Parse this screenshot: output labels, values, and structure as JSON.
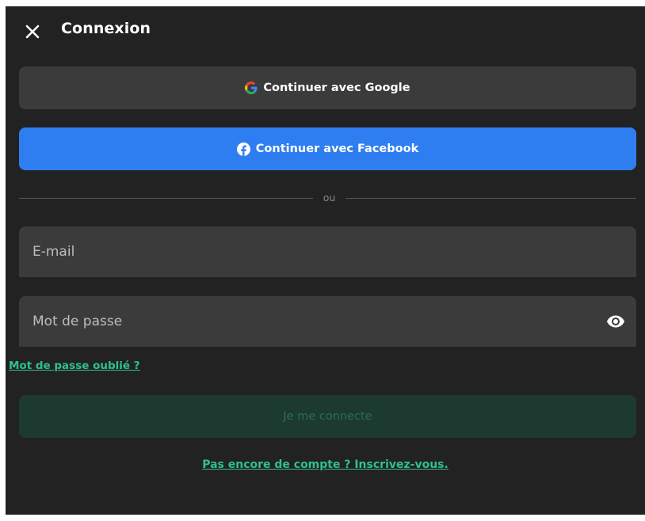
{
  "header": {
    "title": "Connexion",
    "close_icon": "close-icon"
  },
  "social": {
    "google_label": "Continuer avec Google",
    "google_icon": "google-icon",
    "facebook_label": "Continuer avec Facebook",
    "facebook_icon": "facebook-icon"
  },
  "divider": {
    "text": "ou"
  },
  "form": {
    "email_placeholder": "E-mail",
    "email_value": "",
    "password_placeholder": "Mot de passe",
    "password_value": "",
    "password_toggle_icon": "eye-icon",
    "forgot_label": "Mot de passe oublié ?",
    "submit_label": "Je me connecte"
  },
  "footer": {
    "signup_label": "Pas encore de compte ? Inscrivez-vous."
  },
  "colors": {
    "background": "#222222",
    "surface": "#3b3b3b",
    "facebook_blue": "#2f7ef1",
    "accent_green": "#2fc08f",
    "submit_disabled_bg": "#1c3a30",
    "submit_disabled_text": "#2a6e55"
  }
}
